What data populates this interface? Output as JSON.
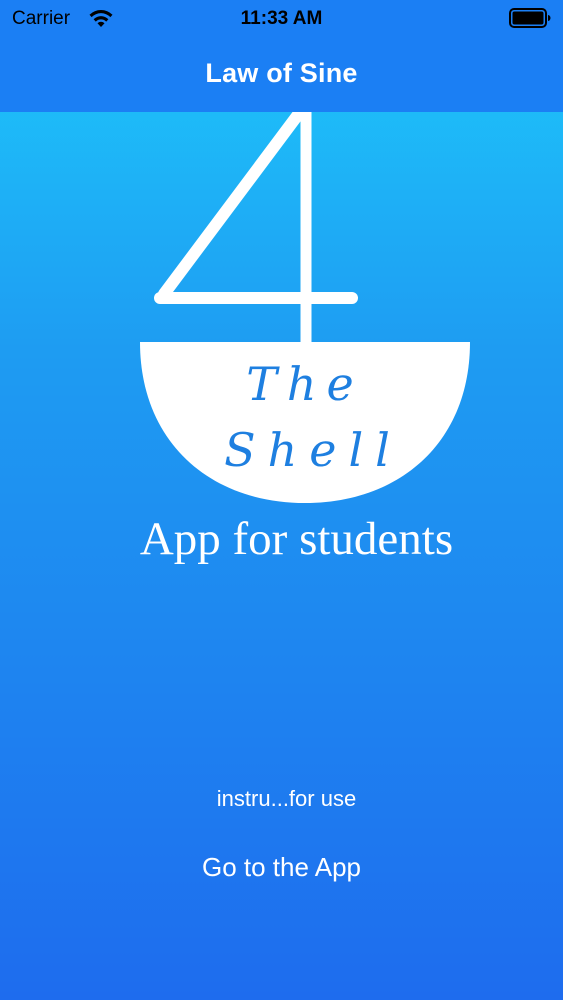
{
  "status_bar": {
    "carrier": "Carrier",
    "time": "11:33 AM",
    "wifi_icon": "wifi-icon",
    "battery_icon": "battery-icon"
  },
  "nav": {
    "title": "Law of Sine"
  },
  "logo": {
    "number": "4",
    "line1": "The",
    "line2": "Shell",
    "text_color": "#1e7fe0"
  },
  "tagline": "App for students",
  "buttons": {
    "instructions_label": "instru...for use",
    "go_label": "Go to the App"
  },
  "colors": {
    "nav_background": "#1b7ff4",
    "gradient_top": "#1dc9fb",
    "gradient_bottom": "#1e6cee",
    "text": "#ffffff"
  }
}
